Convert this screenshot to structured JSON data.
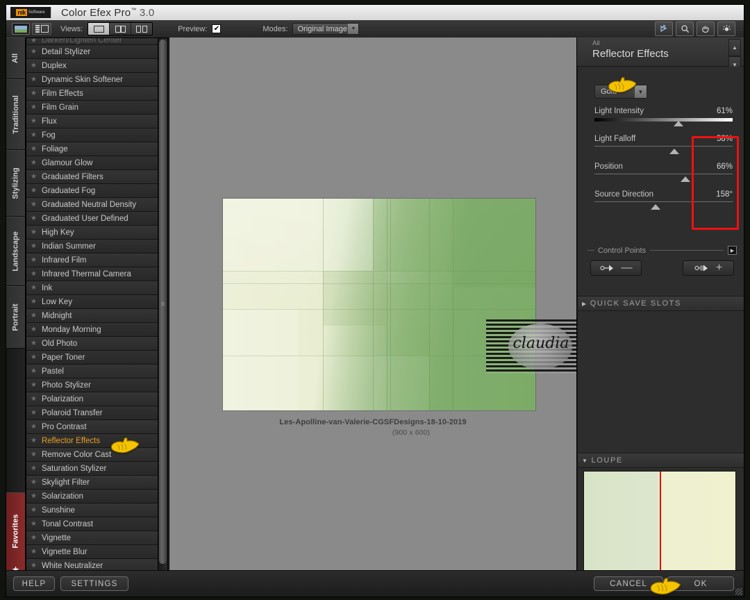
{
  "window": {
    "title": "Color Efex Pro",
    "title_tm": "™",
    "version": "3.0",
    "logo_main": "nik",
    "logo_sub": "Software"
  },
  "toolbar": {
    "image_view_icon": "photo-thumb-icon",
    "list_view_icon": "list-view-icon",
    "views_label": "Views:",
    "views": [
      {
        "name": "single-view",
        "icon": "single-pane-icon",
        "active": true
      },
      {
        "name": "split-view",
        "icon": "split-pane-icon",
        "active": false
      },
      {
        "name": "side-by-side-view",
        "icon": "two-pane-icon",
        "active": false
      }
    ],
    "preview_label": "Preview:",
    "preview_checked": true,
    "modes_label": "Modes:",
    "modes_value": "Original Image",
    "tools": [
      {
        "name": "pointer-tool-icon",
        "label": "Pointer"
      },
      {
        "name": "zoom-tool-icon",
        "label": "Zoom"
      },
      {
        "name": "pan-hand-tool-icon",
        "label": "Pan"
      },
      {
        "name": "loupe-tool-icon",
        "label": "Loupe"
      }
    ]
  },
  "category_tabs": [
    {
      "label": "All",
      "active": true
    },
    {
      "label": "Traditional",
      "active": false
    },
    {
      "label": "Stylizing",
      "active": false
    },
    {
      "label": "Landscape",
      "active": false
    },
    {
      "label": "Portrait",
      "active": false
    }
  ],
  "favorites_tab": {
    "label": "Favorites",
    "icon": "star-icon"
  },
  "filter_list": {
    "clipped_top_item": "Darken/Lighten Center",
    "star_icon": "★",
    "items": [
      {
        "label": "Detail Stylizer",
        "selected": false
      },
      {
        "label": "Duplex",
        "selected": false
      },
      {
        "label": "Dynamic Skin Softener",
        "selected": false
      },
      {
        "label": "Film Effects",
        "selected": false
      },
      {
        "label": "Film Grain",
        "selected": false
      },
      {
        "label": "Flux",
        "selected": false
      },
      {
        "label": "Fog",
        "selected": false
      },
      {
        "label": "Foliage",
        "selected": false
      },
      {
        "label": "Glamour Glow",
        "selected": false
      },
      {
        "label": "Graduated Filters",
        "selected": false
      },
      {
        "label": "Graduated Fog",
        "selected": false
      },
      {
        "label": "Graduated Neutral Density",
        "selected": false
      },
      {
        "label": "Graduated User Defined",
        "selected": false
      },
      {
        "label": "High Key",
        "selected": false
      },
      {
        "label": "Indian Summer",
        "selected": false
      },
      {
        "label": "Infrared Film",
        "selected": false
      },
      {
        "label": "Infrared Thermal Camera",
        "selected": false
      },
      {
        "label": "Ink",
        "selected": false
      },
      {
        "label": "Low Key",
        "selected": false
      },
      {
        "label": "Midnight",
        "selected": false
      },
      {
        "label": "Monday Morning",
        "selected": false
      },
      {
        "label": "Old Photo",
        "selected": false
      },
      {
        "label": "Paper Toner",
        "selected": false
      },
      {
        "label": "Pastel",
        "selected": false
      },
      {
        "label": "Photo Stylizer",
        "selected": false
      },
      {
        "label": "Polarization",
        "selected": false
      },
      {
        "label": "Polaroid Transfer",
        "selected": false
      },
      {
        "label": "Pro Contrast",
        "selected": false
      },
      {
        "label": "Reflector Effects",
        "selected": true
      },
      {
        "label": "Remove Color Cast",
        "selected": false
      },
      {
        "label": "Saturation Stylizer",
        "selected": false
      },
      {
        "label": "Skylight Filter",
        "selected": false
      },
      {
        "label": "Solarization",
        "selected": false
      },
      {
        "label": "Sunshine",
        "selected": false
      },
      {
        "label": "Tonal Contrast",
        "selected": false
      },
      {
        "label": "Vignette",
        "selected": false
      },
      {
        "label": "Vignette Blur",
        "selected": false
      },
      {
        "label": "White Neutralizer",
        "selected": false
      }
    ]
  },
  "canvas": {
    "caption": "Les-Apolline-van-Valerie-CGSFDesigns-18-10-2019",
    "dimensions": "(900 x 600)",
    "watermark_text": "claudia"
  },
  "right_panel": {
    "breadcrumb": "All",
    "effect_name": "Reflector Effects",
    "scroll_up_icon": "chevron-up-icon",
    "scroll_down_icon": "chevron-down-icon",
    "preset_value": "Gold",
    "highlight_color": "#f01010",
    "sliders": [
      {
        "label": "Light Intensity",
        "value": "61%",
        "percent": 61,
        "gradient": true
      },
      {
        "label": "Light Falloff",
        "value": "58%",
        "percent": 58,
        "gradient": false
      },
      {
        "label": "Position",
        "value": "66%",
        "percent": 66,
        "gradient": false
      },
      {
        "label": "Source Direction",
        "value": "158°",
        "percent": 44,
        "gradient": false
      }
    ],
    "control_points": {
      "legend": "Control Points",
      "expand_icon": "play-triangle-icon",
      "remove_button": {
        "name": "remove-control-point-button",
        "icon": "control-point-minus-icon",
        "symbol": "—"
      },
      "add_button": {
        "name": "add-control-point-button",
        "icon": "control-point-plus-icon",
        "symbol": "+"
      }
    },
    "quick_save_slots": {
      "label": "QUICK SAVE SLOTS",
      "expanded": false,
      "tri": "▶"
    },
    "loupe": {
      "label": "LOUPE",
      "expanded": true,
      "tri": "▼",
      "pin_icon": "pin-icon"
    }
  },
  "bottom_bar": {
    "help": "HELP",
    "settings": "SETTINGS",
    "cancel": "CANCEL",
    "ok": "OK"
  },
  "cursors": {
    "pointing_hand_icon": "pointing-hand-cursor"
  }
}
